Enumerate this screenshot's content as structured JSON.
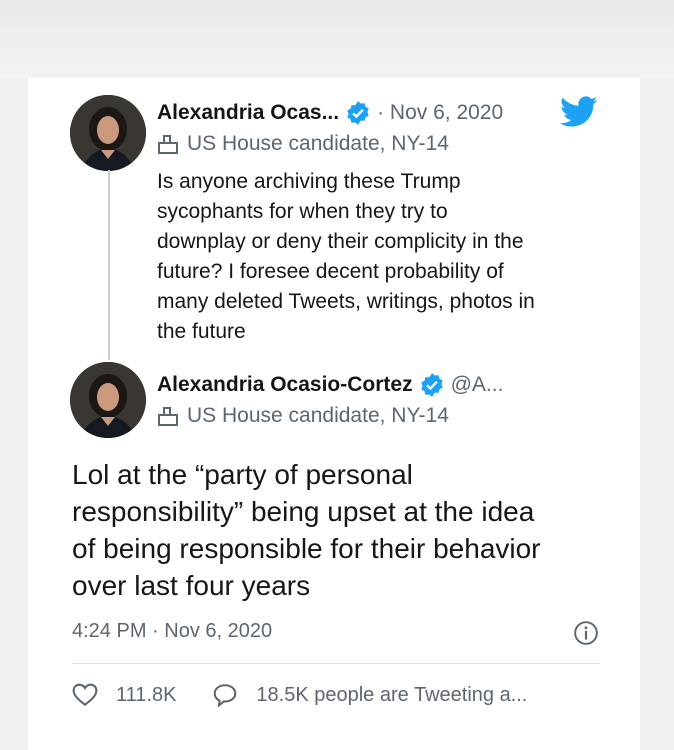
{
  "quoted_tweet": {
    "author_name": "Alexandria Ocas...",
    "date": "· Nov 6, 2020",
    "subtitle": "US House candidate, NY-14",
    "text_lines": [
      "Is anyone archiving these Trump",
      "sycophants for when they try to",
      "downplay or deny their complicity in the",
      "future? I foresee decent probability of",
      "many deleted Tweets, writings, photos in",
      "the future"
    ]
  },
  "main_tweet": {
    "author_name": "Alexandria Ocasio-Cortez",
    "handle": "@A...",
    "subtitle": "US House candidate, NY-14",
    "text_lines": [
      "Lol at the “party of personal",
      "responsibility” being upset at the idea",
      "of being responsible for their behavior",
      "over last four years"
    ],
    "timestamp": "4:24 PM · Nov 6, 2020",
    "likes": "111.8K",
    "tweeting": "18.5K people are Tweeting a..."
  },
  "icons": [
    "twitter-bird-icon",
    "verified-badge-icon",
    "ballot-box-icon",
    "info-icon",
    "heart-icon",
    "speech-bubble-icon"
  ],
  "colors": {
    "twitter_blue": "#1da1f2",
    "text": "#14171a",
    "secondary": "#5b6670"
  }
}
